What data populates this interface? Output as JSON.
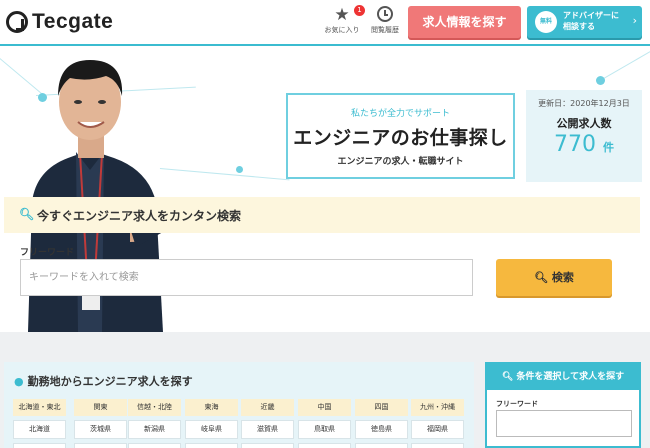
{
  "header": {
    "logo_text": "Tecgate",
    "favorites_label": "お気に入り",
    "favorites_count": "1",
    "history_label": "閲覧履歴",
    "search_jobs_label": "求人情報を探す",
    "adviser_free_badge": "無料",
    "adviser_line1": "アドバイザーに",
    "adviser_line2": "相談する"
  },
  "hero": {
    "catch_sub": "私たちが全力でサポート",
    "catch_main": "エンジニアのお仕事探し",
    "catch_desc": "エンジニアの求人・転職サイト",
    "updated_label": "更新日：2020年12月3日",
    "open_jobs_label": "公開求人数",
    "open_jobs_count": "770",
    "open_jobs_unit": "件"
  },
  "quick_search": {
    "title": "今すぐエンジニア求人をカンタン検索",
    "freeword_label": "フリーワード",
    "input_placeholder": "キーワードを入れて検索",
    "button_label": "検索"
  },
  "area_search": {
    "title": "勤務地からエンジニア求人を探す",
    "regions": [
      "北海道・東北",
      "関東",
      "信越・北陸",
      "東海",
      "近畿",
      "中国",
      "四国",
      "九州・沖縄"
    ],
    "prefectures": [
      "北海道",
      "茨城県",
      "新潟県",
      "岐阜県",
      "滋賀県",
      "鳥取県",
      "徳島県",
      "福岡県"
    ]
  },
  "condition_search": {
    "title": "条件を選択して求人を探す",
    "freeword_label": "フリーワード"
  },
  "colors": {
    "accent": "#3cbcd0",
    "cta_red": "#f07878",
    "cta_yellow": "#f6b83e",
    "panel_yellow": "#fdf6dd"
  }
}
